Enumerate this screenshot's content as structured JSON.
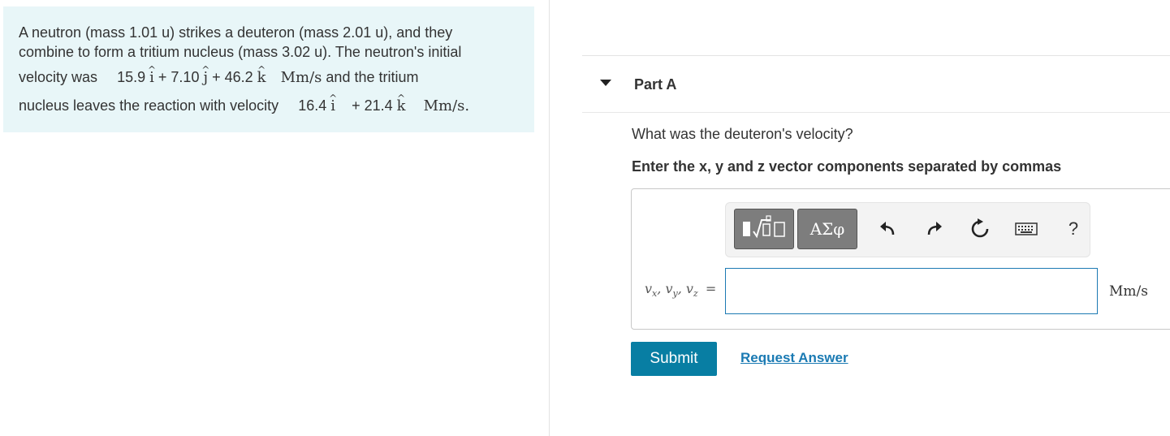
{
  "problem": {
    "line1": "A neutron (mass 1.01 u) strikes a deuteron (mass 2.01 u), and they",
    "line2": "combine to form a tritium nucleus (mass 3.02 u). The neutron's initial",
    "line3_pre": "velocity was",
    "v_neutron": {
      "x": "15.9",
      "plus1": "+ 7.10",
      "plus2": "+  46.2",
      "unit": "Mm/s"
    },
    "line3_post": "and the tritium",
    "line4_pre": "nucleus leaves the reaction with velocity",
    "v_tritium": {
      "x": "16.4",
      "plus": "+  21.4",
      "unit": "Mm/s."
    },
    "unit_vectors": {
      "i": "i",
      "j": "j",
      "k": "k"
    }
  },
  "part": {
    "title": "Part A"
  },
  "question": "What was the deuteron's velocity?",
  "instruction": "Enter the x, y and z vector components separated by commas",
  "toolbar": {
    "greek_label": "ΑΣφ",
    "help_label": "?",
    "icons": [
      "templates-icon",
      "undo-icon",
      "redo-icon",
      "reset-icon",
      "keyboard-icon",
      "help-icon"
    ]
  },
  "answer": {
    "label_v": "v",
    "subs": [
      "x",
      "y",
      "z"
    ],
    "equals": "=",
    "value": "",
    "units": "Mm/s"
  },
  "buttons": {
    "submit": "Submit",
    "request_answer": "Request Answer"
  },
  "colors": {
    "panel_bg": "#e8f6f8",
    "submit_bg": "#087ea3",
    "link": "#1a7ab3",
    "input_border": "#1c7ab3"
  }
}
